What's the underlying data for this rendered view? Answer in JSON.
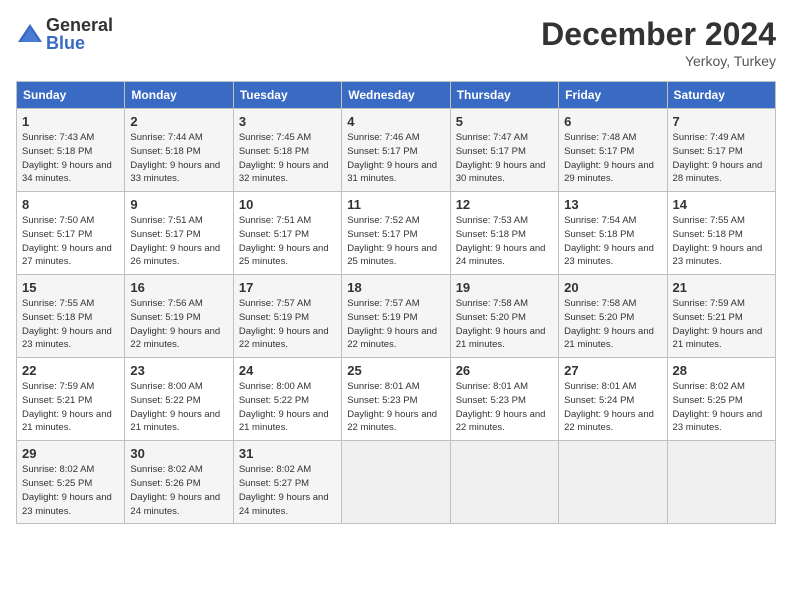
{
  "header": {
    "logo_general": "General",
    "logo_blue": "Blue",
    "month_title": "December 2024",
    "location": "Yerkoy, Turkey"
  },
  "days_of_week": [
    "Sunday",
    "Monday",
    "Tuesday",
    "Wednesday",
    "Thursday",
    "Friday",
    "Saturday"
  ],
  "weeks": [
    [
      {
        "day": "1",
        "sunrise": "Sunrise: 7:43 AM",
        "sunset": "Sunset: 5:18 PM",
        "daylight": "Daylight: 9 hours and 34 minutes."
      },
      {
        "day": "2",
        "sunrise": "Sunrise: 7:44 AM",
        "sunset": "Sunset: 5:18 PM",
        "daylight": "Daylight: 9 hours and 33 minutes."
      },
      {
        "day": "3",
        "sunrise": "Sunrise: 7:45 AM",
        "sunset": "Sunset: 5:18 PM",
        "daylight": "Daylight: 9 hours and 32 minutes."
      },
      {
        "day": "4",
        "sunrise": "Sunrise: 7:46 AM",
        "sunset": "Sunset: 5:17 PM",
        "daylight": "Daylight: 9 hours and 31 minutes."
      },
      {
        "day": "5",
        "sunrise": "Sunrise: 7:47 AM",
        "sunset": "Sunset: 5:17 PM",
        "daylight": "Daylight: 9 hours and 30 minutes."
      },
      {
        "day": "6",
        "sunrise": "Sunrise: 7:48 AM",
        "sunset": "Sunset: 5:17 PM",
        "daylight": "Daylight: 9 hours and 29 minutes."
      },
      {
        "day": "7",
        "sunrise": "Sunrise: 7:49 AM",
        "sunset": "Sunset: 5:17 PM",
        "daylight": "Daylight: 9 hours and 28 minutes."
      }
    ],
    [
      {
        "day": "8",
        "sunrise": "Sunrise: 7:50 AM",
        "sunset": "Sunset: 5:17 PM",
        "daylight": "Daylight: 9 hours and 27 minutes."
      },
      {
        "day": "9",
        "sunrise": "Sunrise: 7:51 AM",
        "sunset": "Sunset: 5:17 PM",
        "daylight": "Daylight: 9 hours and 26 minutes."
      },
      {
        "day": "10",
        "sunrise": "Sunrise: 7:51 AM",
        "sunset": "Sunset: 5:17 PM",
        "daylight": "Daylight: 9 hours and 25 minutes."
      },
      {
        "day": "11",
        "sunrise": "Sunrise: 7:52 AM",
        "sunset": "Sunset: 5:17 PM",
        "daylight": "Daylight: 9 hours and 25 minutes."
      },
      {
        "day": "12",
        "sunrise": "Sunrise: 7:53 AM",
        "sunset": "Sunset: 5:18 PM",
        "daylight": "Daylight: 9 hours and 24 minutes."
      },
      {
        "day": "13",
        "sunrise": "Sunrise: 7:54 AM",
        "sunset": "Sunset: 5:18 PM",
        "daylight": "Daylight: 9 hours and 23 minutes."
      },
      {
        "day": "14",
        "sunrise": "Sunrise: 7:55 AM",
        "sunset": "Sunset: 5:18 PM",
        "daylight": "Daylight: 9 hours and 23 minutes."
      }
    ],
    [
      {
        "day": "15",
        "sunrise": "Sunrise: 7:55 AM",
        "sunset": "Sunset: 5:18 PM",
        "daylight": "Daylight: 9 hours and 23 minutes."
      },
      {
        "day": "16",
        "sunrise": "Sunrise: 7:56 AM",
        "sunset": "Sunset: 5:19 PM",
        "daylight": "Daylight: 9 hours and 22 minutes."
      },
      {
        "day": "17",
        "sunrise": "Sunrise: 7:57 AM",
        "sunset": "Sunset: 5:19 PM",
        "daylight": "Daylight: 9 hours and 22 minutes."
      },
      {
        "day": "18",
        "sunrise": "Sunrise: 7:57 AM",
        "sunset": "Sunset: 5:19 PM",
        "daylight": "Daylight: 9 hours and 22 minutes."
      },
      {
        "day": "19",
        "sunrise": "Sunrise: 7:58 AM",
        "sunset": "Sunset: 5:20 PM",
        "daylight": "Daylight: 9 hours and 21 minutes."
      },
      {
        "day": "20",
        "sunrise": "Sunrise: 7:58 AM",
        "sunset": "Sunset: 5:20 PM",
        "daylight": "Daylight: 9 hours and 21 minutes."
      },
      {
        "day": "21",
        "sunrise": "Sunrise: 7:59 AM",
        "sunset": "Sunset: 5:21 PM",
        "daylight": "Daylight: 9 hours and 21 minutes."
      }
    ],
    [
      {
        "day": "22",
        "sunrise": "Sunrise: 7:59 AM",
        "sunset": "Sunset: 5:21 PM",
        "daylight": "Daylight: 9 hours and 21 minutes."
      },
      {
        "day": "23",
        "sunrise": "Sunrise: 8:00 AM",
        "sunset": "Sunset: 5:22 PM",
        "daylight": "Daylight: 9 hours and 21 minutes."
      },
      {
        "day": "24",
        "sunrise": "Sunrise: 8:00 AM",
        "sunset": "Sunset: 5:22 PM",
        "daylight": "Daylight: 9 hours and 21 minutes."
      },
      {
        "day": "25",
        "sunrise": "Sunrise: 8:01 AM",
        "sunset": "Sunset: 5:23 PM",
        "daylight": "Daylight: 9 hours and 22 minutes."
      },
      {
        "day": "26",
        "sunrise": "Sunrise: 8:01 AM",
        "sunset": "Sunset: 5:23 PM",
        "daylight": "Daylight: 9 hours and 22 minutes."
      },
      {
        "day": "27",
        "sunrise": "Sunrise: 8:01 AM",
        "sunset": "Sunset: 5:24 PM",
        "daylight": "Daylight: 9 hours and 22 minutes."
      },
      {
        "day": "28",
        "sunrise": "Sunrise: 8:02 AM",
        "sunset": "Sunset: 5:25 PM",
        "daylight": "Daylight: 9 hours and 23 minutes."
      }
    ],
    [
      {
        "day": "29",
        "sunrise": "Sunrise: 8:02 AM",
        "sunset": "Sunset: 5:25 PM",
        "daylight": "Daylight: 9 hours and 23 minutes."
      },
      {
        "day": "30",
        "sunrise": "Sunrise: 8:02 AM",
        "sunset": "Sunset: 5:26 PM",
        "daylight": "Daylight: 9 hours and 24 minutes."
      },
      {
        "day": "31",
        "sunrise": "Sunrise: 8:02 AM",
        "sunset": "Sunset: 5:27 PM",
        "daylight": "Daylight: 9 hours and 24 minutes."
      },
      null,
      null,
      null,
      null
    ]
  ]
}
